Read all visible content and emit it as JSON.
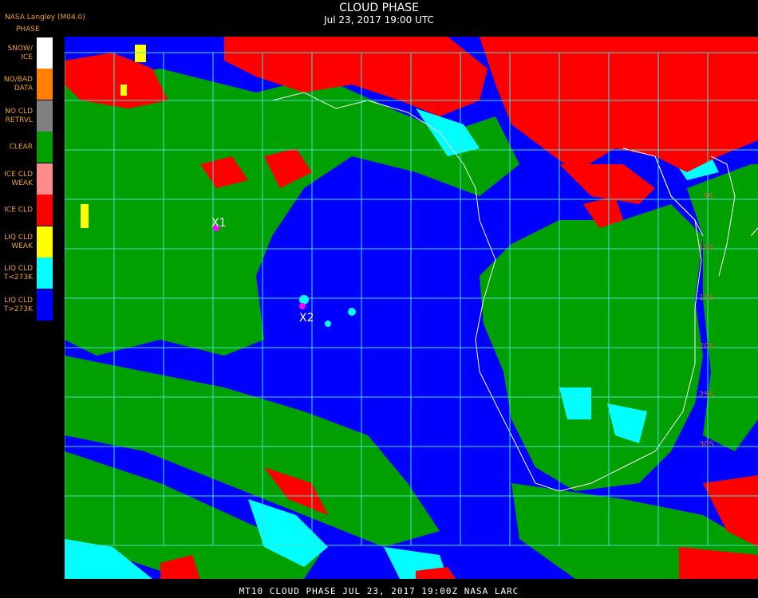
{
  "header": {
    "title": "CLOUD PHASE",
    "subtitle": "Jul 23, 2017 19:00 UTC",
    "producer": "NASA Langley (M04.0)",
    "legend_heading": "PHASE"
  },
  "legend": {
    "items": [
      {
        "label": "SNOW/\nICE",
        "color": "#ffffff"
      },
      {
        "label": "NO/BAD\nDATA",
        "color": "#ff7f00"
      },
      {
        "label": "NO CLD\nRETRVL",
        "color": "#808080"
      },
      {
        "label": "CLEAR",
        "color": "#00a000"
      },
      {
        "label": "ICE CLD\nWEAK",
        "color": "#ff8c8c"
      },
      {
        "label": "ICE CLD",
        "color": "#ff0000"
      },
      {
        "label": "LIQ CLD\nWEAK",
        "color": "#ffff00"
      },
      {
        "label": "LIQ CLD\nT<273K",
        "color": "#00ffff"
      },
      {
        "label": "LIQ CLD\nT>273K",
        "color": "#0000ff"
      }
    ]
  },
  "map": {
    "markers": [
      {
        "label": "X1",
        "color": "#ff00ff"
      },
      {
        "label": "X2",
        "color": "#ff00ff"
      }
    ],
    "lat_labels": [
      "5S",
      "10S",
      "15S",
      "20S",
      "25S",
      "30S"
    ],
    "colors": {
      "clear": "#00a000",
      "liq_warm": "#0000ff",
      "liq_cold": "#00ffff",
      "ice": "#ff0000",
      "grid": "#40e0d0",
      "coast": "#ffffff"
    }
  },
  "footer": {
    "text": "MT10  CLOUD PHASE   JUL 23, 2017 19:00Z   NASA LARC"
  }
}
